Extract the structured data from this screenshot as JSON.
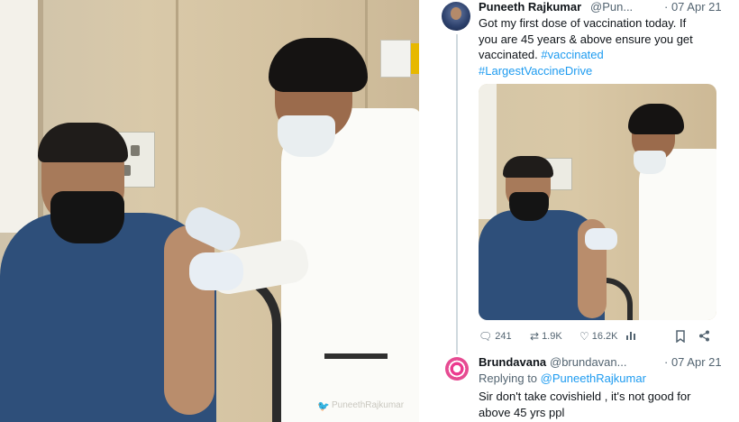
{
  "left_photo": {
    "watermark": "PuneethRajkumar"
  },
  "tweet": {
    "author_name": "Puneeth Rajkumar",
    "author_handle": "@Pun...",
    "date": "· 07 Apr 21",
    "text_line1": "Got my first dose of vaccination today. If",
    "text_line2": "you are 45 years & above ensure you get",
    "text_line3": "vaccinated. ",
    "hashtag1": "#vaccinated",
    "hashtag2": "#LargestVaccineDrive",
    "actions": {
      "replies": "241",
      "retweets": "1.9K",
      "likes": "16.2K",
      "reply_icon": "reply-icon",
      "retweet_icon": "retweet-icon",
      "like_icon": "heart-icon",
      "views_icon": "views-icon",
      "bookmark_icon": "bookmark-icon",
      "share_icon": "share-icon"
    }
  },
  "reply": {
    "author_name": "Brundavana",
    "author_handle": "@brundavan...",
    "date": "· 07 Apr 21",
    "replying_prefix": "Replying to ",
    "replying_handle": "@PuneethRajkumar",
    "text_line1": "Sir don't take covishield , it's not good for",
    "text_line2": "above 45 yrs ppl"
  },
  "colors": {
    "link": "#1d9bf0",
    "secondary_text": "#536471",
    "primary_text": "#0f1419"
  }
}
